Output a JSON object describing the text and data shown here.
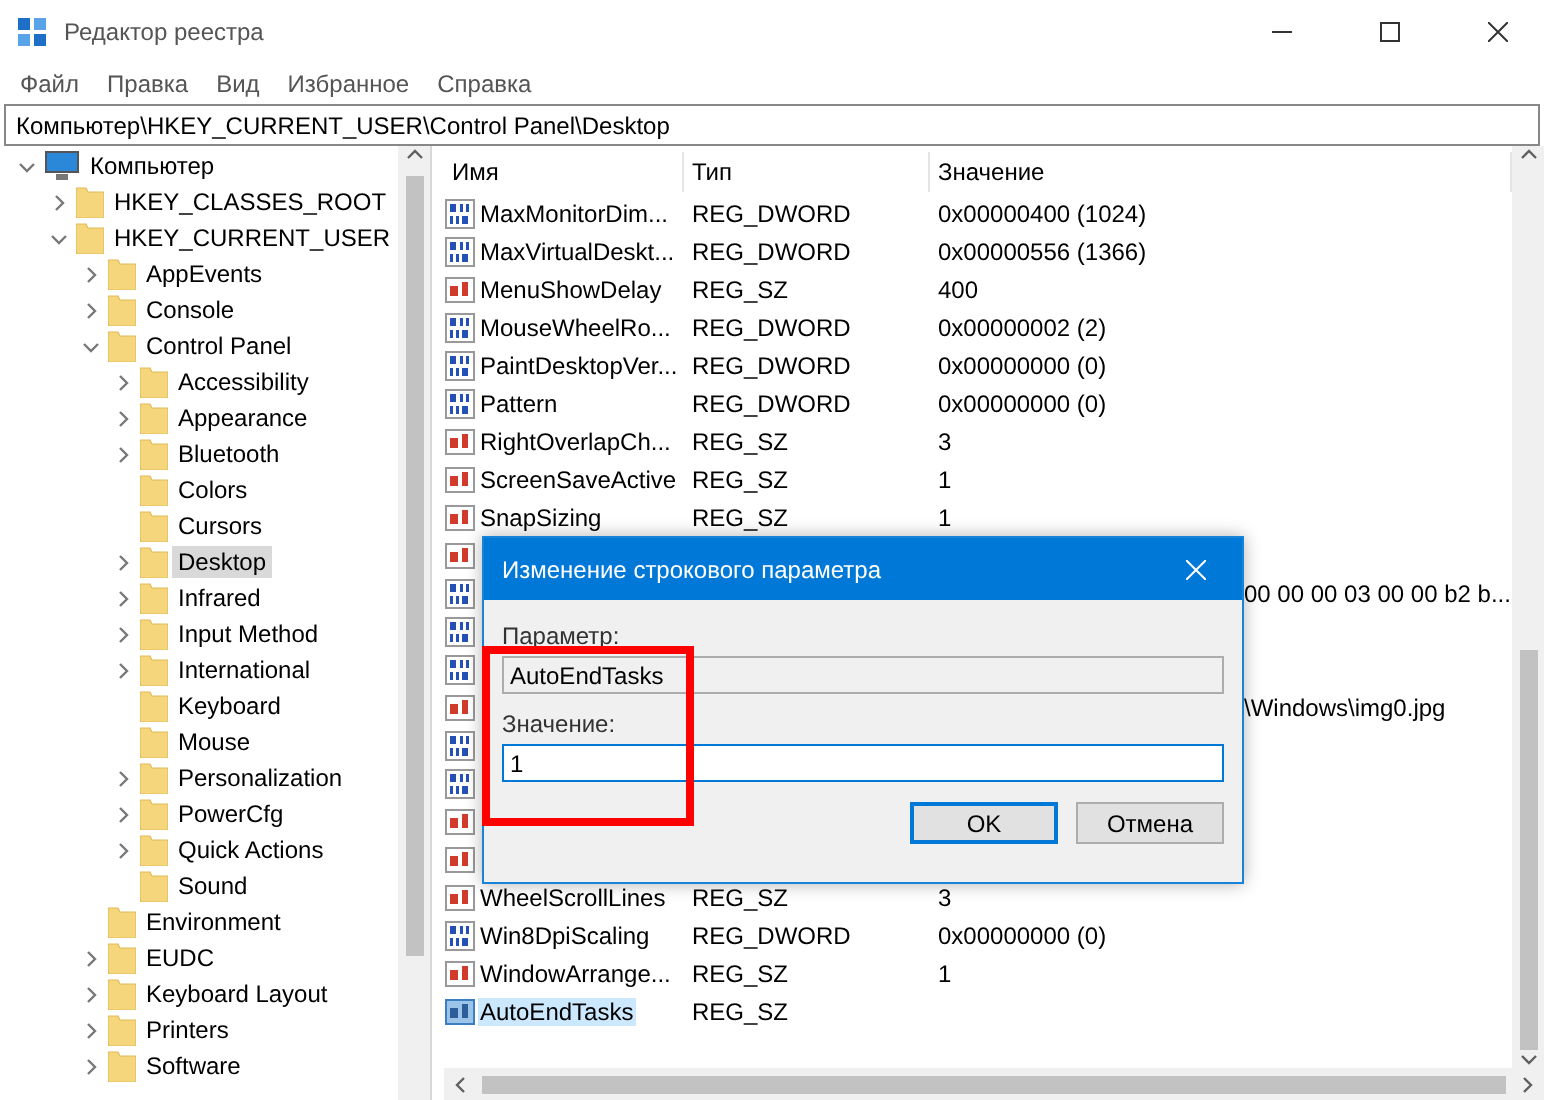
{
  "window": {
    "title": "Редактор реестра"
  },
  "menu": [
    "Файл",
    "Правка",
    "Вид",
    "Избранное",
    "Справка"
  ],
  "address": "Компьютер\\HKEY_CURRENT_USER\\Control Panel\\Desktop",
  "tree": [
    {
      "label": "Компьютер",
      "kind": "computer",
      "expanded": true,
      "selected": false,
      "children": [
        {
          "label": "HKEY_CLASSES_ROOT",
          "expanded": false,
          "selected": false
        },
        {
          "label": "HKEY_CURRENT_USER",
          "expanded": true,
          "selected": false,
          "children": [
            {
              "label": "AppEvents",
              "expanded": false,
              "selected": false
            },
            {
              "label": "Console",
              "expanded": false,
              "selected": false
            },
            {
              "label": "Control Panel",
              "expanded": true,
              "selected": false,
              "children": [
                {
                  "label": "Accessibility",
                  "expanded": false,
                  "selected": false
                },
                {
                  "label": "Appearance",
                  "expanded": false,
                  "selected": false
                },
                {
                  "label": "Bluetooth",
                  "expanded": false,
                  "selected": false
                },
                {
                  "label": "Colors",
                  "selected": false
                },
                {
                  "label": "Cursors",
                  "selected": false
                },
                {
                  "label": "Desktop",
                  "expanded": false,
                  "selected": true
                },
                {
                  "label": "Infrared",
                  "expanded": false,
                  "selected": false
                },
                {
                  "label": "Input Method",
                  "expanded": false,
                  "selected": false
                },
                {
                  "label": "International",
                  "expanded": false,
                  "selected": false
                },
                {
                  "label": "Keyboard",
                  "selected": false
                },
                {
                  "label": "Mouse",
                  "selected": false
                },
                {
                  "label": "Personalization",
                  "expanded": false,
                  "selected": false
                },
                {
                  "label": "PowerCfg",
                  "expanded": false,
                  "selected": false
                },
                {
                  "label": "Quick Actions",
                  "expanded": false,
                  "selected": false
                },
                {
                  "label": "Sound",
                  "selected": false
                }
              ]
            },
            {
              "label": "Environment",
              "selected": false
            },
            {
              "label": "EUDC",
              "expanded": false,
              "selected": false
            },
            {
              "label": "Keyboard Layout",
              "expanded": false,
              "selected": false
            },
            {
              "label": "Printers",
              "expanded": false,
              "selected": false
            },
            {
              "label": "Software",
              "expanded": false,
              "selected": false
            }
          ]
        }
      ]
    }
  ],
  "table": {
    "columns": [
      "Имя",
      "Тип",
      "Значение"
    ],
    "rows": [
      {
        "kind": "dword",
        "name": "MaxMonitorDim...",
        "type": "REG_DWORD",
        "value": "0x00000400 (1024)",
        "selected": false
      },
      {
        "kind": "dword",
        "name": "MaxVirtualDeskt...",
        "type": "REG_DWORD",
        "value": "0x00000556 (1366)",
        "selected": false
      },
      {
        "kind": "string",
        "name": "MenuShowDelay",
        "type": "REG_SZ",
        "value": "400",
        "selected": false
      },
      {
        "kind": "dword",
        "name": "MouseWheelRo...",
        "type": "REG_DWORD",
        "value": "0x00000002 (2)",
        "selected": false
      },
      {
        "kind": "dword",
        "name": "PaintDesktopVer...",
        "type": "REG_DWORD",
        "value": "0x00000000 (0)",
        "selected": false
      },
      {
        "kind": "dword",
        "name": "Pattern",
        "type": "REG_DWORD",
        "value": "0x00000000 (0)",
        "selected": false
      },
      {
        "kind": "string",
        "name": "RightOverlapCh...",
        "type": "REG_SZ",
        "value": "3",
        "selected": false
      },
      {
        "kind": "string",
        "name": "ScreenSaveActive",
        "type": "REG_SZ",
        "value": "1",
        "selected": false
      },
      {
        "kind": "string",
        "name": "SnapSizing",
        "type": "REG_SZ",
        "value": "1",
        "selected": false
      },
      {
        "kind": "string"
      },
      {
        "kind": "dword",
        "value_tail": "00 00 00 03 00 00 b2 b..."
      },
      {
        "kind": "dword"
      },
      {
        "kind": "dword"
      },
      {
        "kind": "string",
        "value_tail": "\\Windows\\img0.jpg"
      },
      {
        "kind": "dword"
      },
      {
        "kind": "dword"
      },
      {
        "kind": "string"
      },
      {
        "kind": "string"
      },
      {
        "kind": "string",
        "name": "WheelScrollLines",
        "type": "REG_SZ",
        "value": "3",
        "selected": false
      },
      {
        "kind": "dword",
        "name": "Win8DpiScaling",
        "type": "REG_DWORD",
        "value": "0x00000000 (0)",
        "selected": false
      },
      {
        "kind": "string",
        "name": "WindowArrange...",
        "type": "REG_SZ",
        "value": "1",
        "selected": false
      },
      {
        "kind": "string",
        "name": "AutoEndTasks",
        "type": "REG_SZ",
        "selected": true
      }
    ]
  },
  "dialog": {
    "title": "Изменение строкового параметра",
    "name_label": "Параметр:",
    "name_value": "AutoEndTasks",
    "value_label": "Значение:",
    "value": "1",
    "buttons": [
      "OK",
      "Отмена"
    ]
  }
}
